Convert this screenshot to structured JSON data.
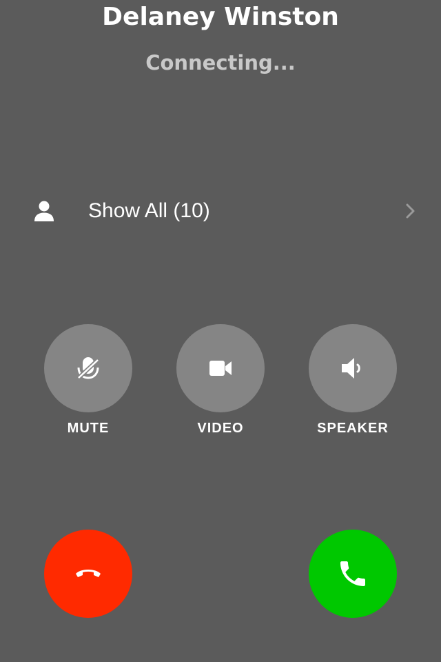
{
  "call": {
    "caller_name": "Delaney Winston",
    "status": "Connecting..."
  },
  "contacts_row": {
    "label": "Show All (10)",
    "icon": "person-icon",
    "chevron": "chevron-right-icon"
  },
  "controls": [
    {
      "label": "MUTE",
      "icon": "microphone-off-icon"
    },
    {
      "label": "VIDEO",
      "icon": "video-camera-icon"
    },
    {
      "label": "SPEAKER",
      "icon": "speaker-icon"
    }
  ],
  "actions": {
    "decline_icon": "hang-up-icon",
    "accept_icon": "phone-icon"
  },
  "colors": {
    "background": "#5b5b5b",
    "control_circle": "#858585",
    "decline": "#ff2a00",
    "accept": "#00c800",
    "status_text": "#c9c9c9"
  }
}
